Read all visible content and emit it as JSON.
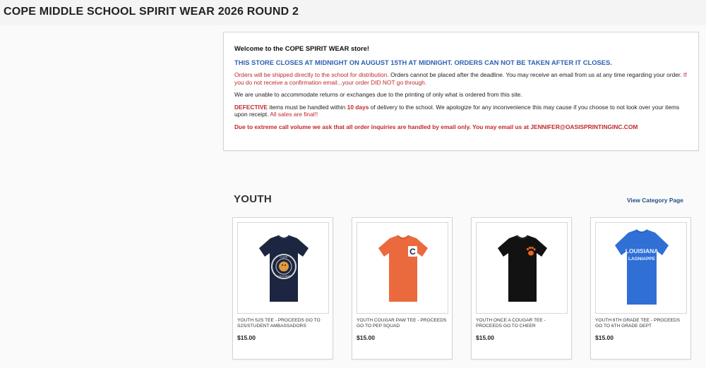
{
  "store": {
    "title": "COPE MIDDLE SCHOOL SPIRIT WEAR 2026 ROUND 2"
  },
  "notice": {
    "welcome": "Welcome to the COPE SPIRIT WEAR store!",
    "closing": "THIS STORE CLOSES AT MIDNIGHT ON AUGUST 15TH AT MIDNIGHT.  ORDERS CAN NOT BE TAKEN AFTER IT CLOSES.",
    "shipping_red": "Orders will be shipped directly to the school for distribution.",
    "shipping_black": "  Orders cannot be placed after the deadline.  You may receive an email from us at any time regarding your order.",
    "shipping_red2": "  If you do not receive a confirmation email...your order DID NOT go through.",
    "returns": "We are unable to accommodate returns or exchanges due to the printing of only what is ordered from this site.",
    "defective_word": "DEFECTIVE",
    "defective_text1": " items must be handled within ",
    "defective_days": "10 days",
    "defective_text2": " of delivery to the school. We apologize for any inconvenience this may cause if you choose to not look over your items upon receipt.",
    "defective_final": "  All sales are final!!",
    "inquiries": "Due to extreme call volume we ask that all order inquiries are handled by email only.  You may email us at JENNIFER@OASISPRINTINGINC.COM"
  },
  "section": {
    "title": "YOUTH",
    "view_link": "View Category Page"
  },
  "products": [
    {
      "name": "YOUTH S2S TEE - PROCEEDS GO TO S2S/STUDENT AMBASSADORS",
      "price": "$15.00",
      "color": "#1c2641",
      "print": "COPE",
      "print2": "COUGARS"
    },
    {
      "name": "YOUTH COUGAR PAW TEE - PROCEEDS GO TO PEP SQUAD",
      "price": "$15.00",
      "color": "#ea6a3d",
      "print": "C"
    },
    {
      "name": "YOUTH ONCE A COUGAR TEE - PROCEEDS GO TO CHEER",
      "price": "$15.00",
      "color": "#121212"
    },
    {
      "name": "YOUTH 6TH GRADE TEE - PROCEEDS GO TO 6TH GRADE DEPT",
      "price": "$15.00",
      "color": "#2f6fd6",
      "print": "LOUISIANA",
      "print2": "LAGNIAPPE"
    }
  ]
}
